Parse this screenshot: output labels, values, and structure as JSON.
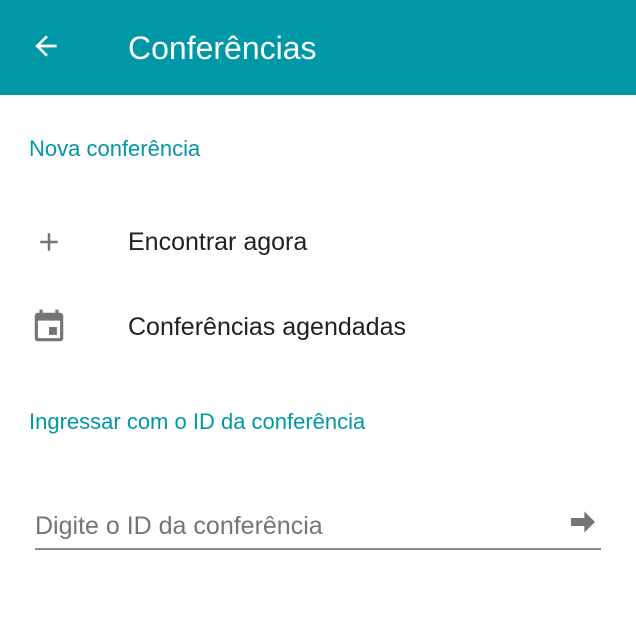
{
  "appbar": {
    "title": "Conferências",
    "back_icon": "arrow-back-icon",
    "background": "#0097a7"
  },
  "new_conference": {
    "header": "Nova conferência",
    "items": [
      {
        "icon": "plus-icon",
        "label": "Encontrar agora"
      },
      {
        "icon": "calendar-icon",
        "label": "Conferências agendadas"
      }
    ]
  },
  "join": {
    "header": "Ingressar com o ID da conferência",
    "input": {
      "value": "",
      "placeholder": "Digite o ID da conferência"
    },
    "submit_icon": "arrow-forward-icon"
  },
  "colors": {
    "accent": "#0097a7",
    "text_primary": "#212121",
    "icon_gray": "#757575"
  }
}
